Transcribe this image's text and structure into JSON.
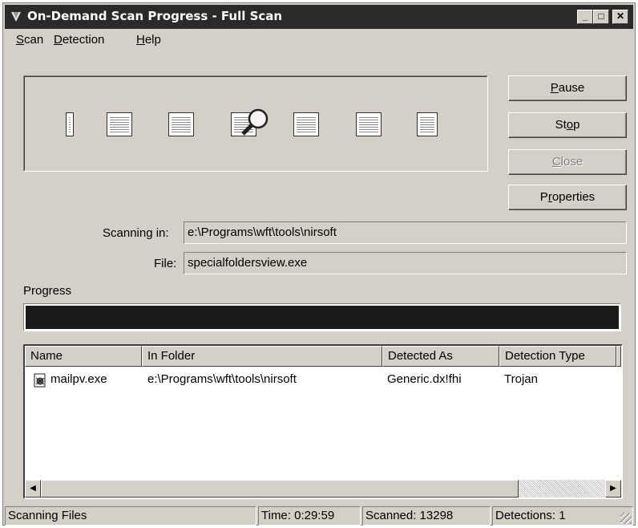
{
  "window": {
    "title": "On-Demand Scan Progress - Full Scan"
  },
  "titlebar_buttons": {
    "minimize": "_",
    "maximize": "□",
    "close": "✕"
  },
  "menu": [
    {
      "pre": "",
      "u": "S",
      "post": "can"
    },
    {
      "pre": "",
      "u": "D",
      "post": "etection"
    },
    {
      "pre": "",
      "u": "H",
      "post": "elp"
    }
  ],
  "buttons": {
    "pause": {
      "pre": "",
      "u": "P",
      "post": "ause"
    },
    "stop": {
      "pre": "St",
      "u": "o",
      "post": "p"
    },
    "close": {
      "pre": "",
      "u": "C",
      "post": "lose"
    },
    "properties": {
      "pre": "P",
      "u": "r",
      "post": "operties"
    }
  },
  "scan": {
    "scanning_in_label": "Scanning in:",
    "scanning_in_value": "e:\\Programs\\wft\\tools\\nirsoft",
    "file_label": "File:",
    "file_value": "specialfoldersview.exe"
  },
  "progress": {
    "label": "Progress",
    "fraction": 1.0
  },
  "results": {
    "columns": [
      "Name",
      "In Folder",
      "Detected As",
      "Detection Type"
    ],
    "rows": [
      {
        "name": "mailpv.exe",
        "folder": "e:\\Programs\\wft\\tools\\nirsoft",
        "detected_as": "Generic.dx!fhi",
        "type": "Trojan"
      }
    ]
  },
  "scrollbar": {
    "left_arrow": "◀",
    "right_arrow": "▶"
  },
  "status": {
    "state": "Scanning Files",
    "time": "Time: 0:29:59",
    "scanned": "Scanned: 13298",
    "detections": "Detections: 1"
  }
}
